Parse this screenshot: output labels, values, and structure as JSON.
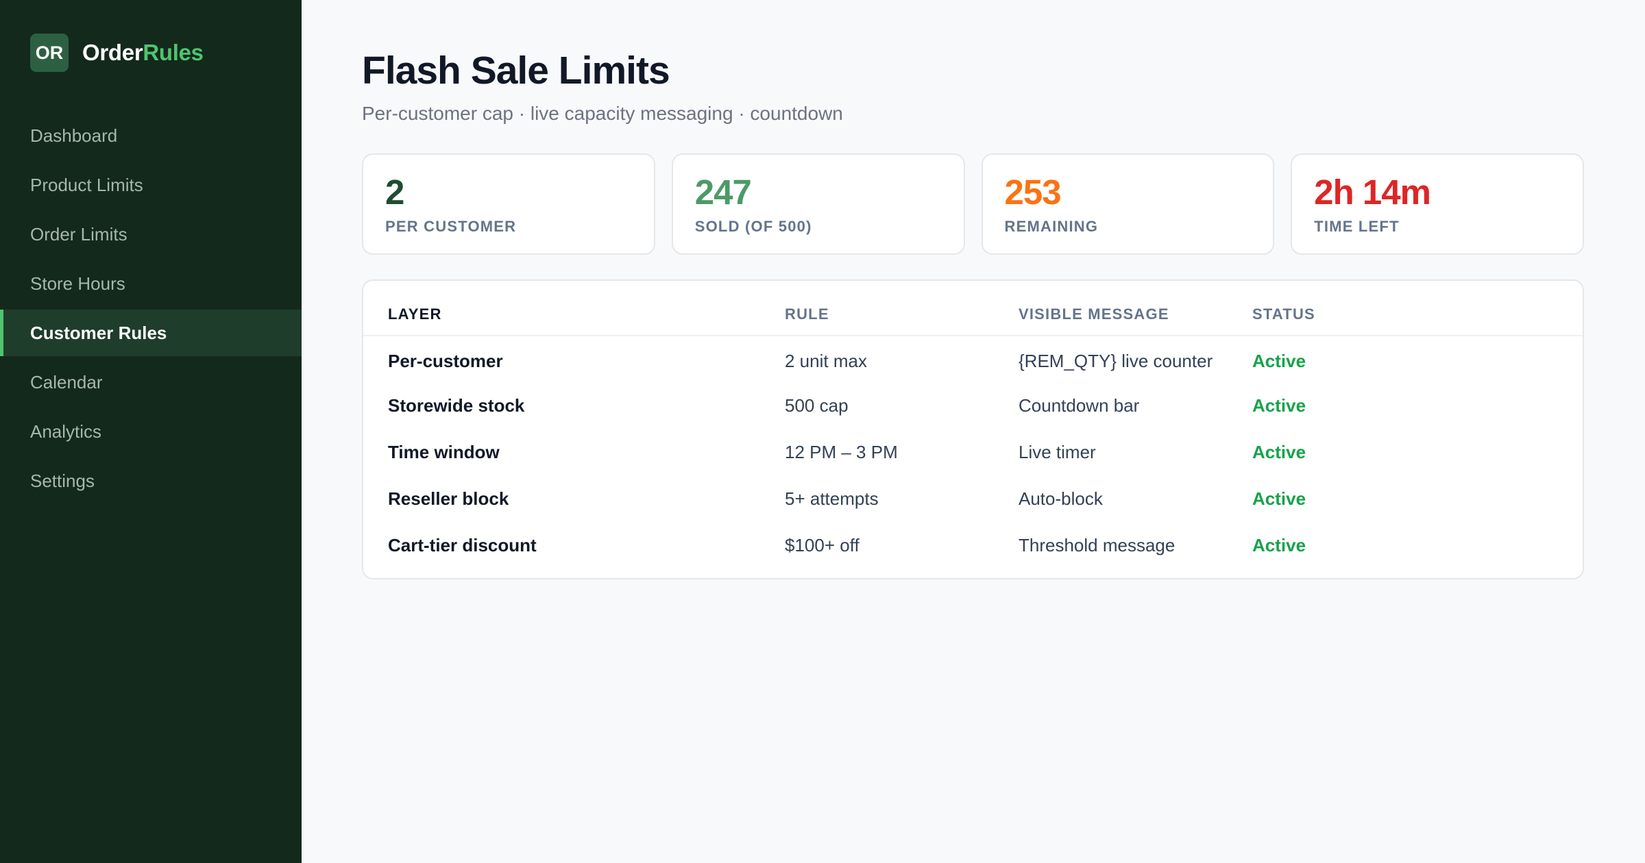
{
  "brand": {
    "badge": "OR",
    "name_part1": "Order",
    "name_part2": "Rules"
  },
  "sidebar": {
    "items": [
      {
        "label": "Dashboard"
      },
      {
        "label": "Product Limits"
      },
      {
        "label": "Order Limits"
      },
      {
        "label": "Store Hours"
      },
      {
        "label": "Customer Rules",
        "active": true
      },
      {
        "label": "Calendar"
      },
      {
        "label": "Analytics"
      },
      {
        "label": "Settings"
      }
    ]
  },
  "header": {
    "title": "Flash Sale Limits",
    "subtitle": "Per-customer cap · live capacity messaging · countdown"
  },
  "stats": [
    {
      "value": "2",
      "label": "PER CUSTOMER",
      "color": "#1f4d31"
    },
    {
      "value": "247",
      "label": "SOLD (OF 500)",
      "color": "#4d9a66"
    },
    {
      "value": "253",
      "label": "REMAINING",
      "color": "#f97316"
    },
    {
      "value": "2h 14m",
      "label": "TIME LEFT",
      "color": "#dc2626"
    }
  ],
  "table": {
    "headers": [
      "LAYER",
      "RULE",
      "VISIBLE MESSAGE",
      "STATUS"
    ],
    "rows": [
      {
        "layer": "Per-customer",
        "rule": "2 unit max",
        "message": "{REM_QTY} live counter",
        "status": "Active"
      },
      {
        "layer": "Storewide stock",
        "rule": "500 cap",
        "message": "Countdown bar",
        "status": "Active"
      },
      {
        "layer": "Time window",
        "rule": "12 PM – 3 PM",
        "message": "Live timer",
        "status": "Active"
      },
      {
        "layer": "Reseller block",
        "rule": "5+ attempts",
        "message": "Auto-block",
        "status": "Active"
      },
      {
        "layer": "Cart-tier discount",
        "rule": "$100+ off",
        "message": "Threshold message",
        "status": "Active"
      }
    ]
  },
  "colors": {
    "sidebar_bg": "#13291c",
    "accent": "#4fc46f",
    "status_active": "#16a34a"
  }
}
